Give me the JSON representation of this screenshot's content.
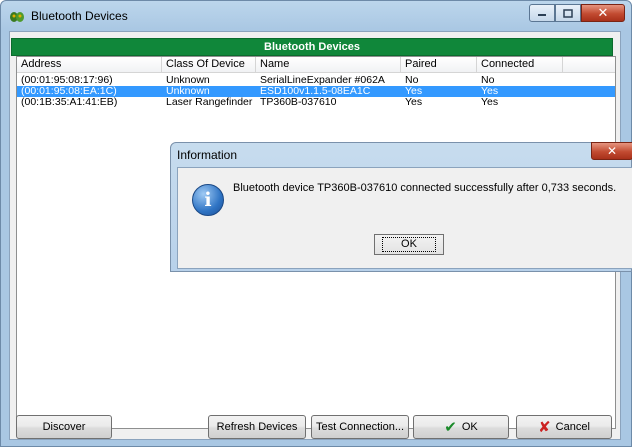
{
  "window": {
    "title": "Bluetooth Devices"
  },
  "banner": "Bluetooth Devices",
  "table": {
    "columns": [
      "Address",
      "Class Of Device",
      "Name",
      "Paired",
      "Connected"
    ],
    "rows": [
      [
        "(00:01:95:08:17:96)",
        "Unknown",
        "SerialLineExpander #062A",
        "No",
        "No"
      ],
      [
        "(00:01:95:08:EA:1C)",
        "Unknown",
        "ESD100v1.1.5-08EA1C",
        "Yes",
        "Yes"
      ],
      [
        "(00:1B:35:A1:41:EB)",
        "Laser Rangefinder",
        "TP360B-037610",
        "Yes",
        "Yes"
      ]
    ],
    "selected_row": 1
  },
  "buttons": {
    "discover": "Discover",
    "refresh": "Refresh Devices",
    "test": "Test Connection...",
    "ok": "OK",
    "cancel": "Cancel"
  },
  "dialog": {
    "title": "Information",
    "message": "Bluetooth device TP360B-037610 connected successfully after 0,733 seconds.",
    "ok": "OK"
  },
  "icons": {
    "app": "bluetooth-devices-app-icon",
    "info": "information-icon",
    "ok": "check-icon",
    "cancel": "x-icon"
  },
  "colors": {
    "banner": "#10873a",
    "selection": "#3399ff",
    "ok_check": "#1a8a2a",
    "cancel_x": "#cc2222"
  }
}
